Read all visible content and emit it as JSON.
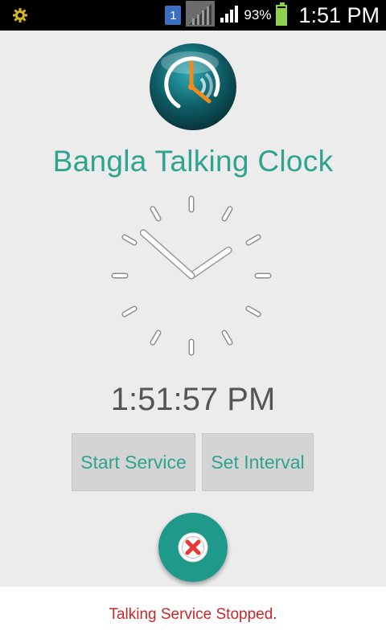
{
  "status_bar": {
    "sim_slot": "1",
    "battery_percent": "93%",
    "battery_level": 0.93,
    "time": "1:51 PM",
    "icons": [
      "usb-debug-icon",
      "sim-card-icon",
      "signal-no-service-icon",
      "signal-strength-icon",
      "battery-icon"
    ],
    "battery_color": "#8fd14f"
  },
  "app": {
    "title": "Bangla Talking Clock",
    "logo_icon": "talking-clock-logo-icon",
    "accent_color": "#2fa48c"
  },
  "clock": {
    "hour": 1,
    "minute": 51,
    "second": 57,
    "digital_time": "1:51:57 PM"
  },
  "buttons": {
    "start_service": "Start Service",
    "set_interval": "Set Interval",
    "stop_icon": "close-circle-icon"
  },
  "toast": {
    "message": "Talking Service Stopped.",
    "color": "#c62828"
  }
}
